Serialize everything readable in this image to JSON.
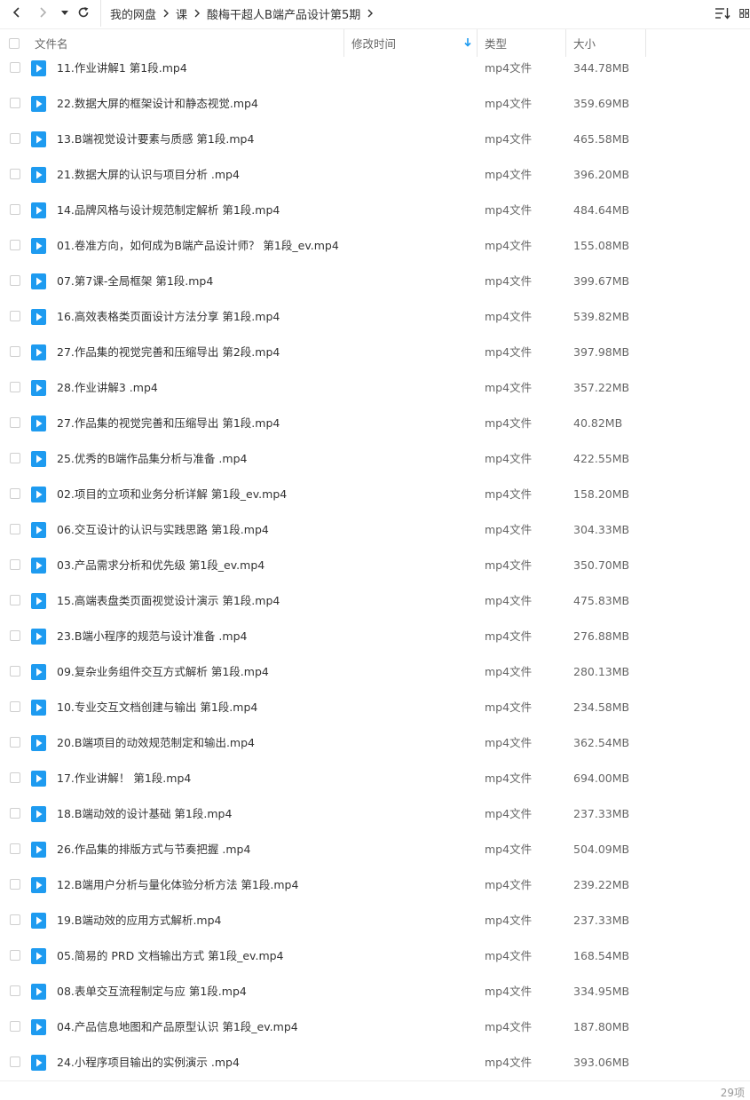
{
  "breadcrumb": [
    "我的网盘",
    "课",
    "酸梅干超人B端产品设计第5期"
  ],
  "columns": {
    "name": "文件名",
    "modified": "修改时间",
    "type": "类型",
    "size": "大小"
  },
  "colors": {
    "file_icon": "#1e9bf0",
    "sort_arrow": "#1e9bf0"
  },
  "files": [
    {
      "name": "11.作业讲解1 第1段.mp4",
      "type": "mp4文件",
      "size": "344.78MB"
    },
    {
      "name": "22.数据大屏的框架设计和静态视觉.mp4",
      "type": "mp4文件",
      "size": "359.69MB"
    },
    {
      "name": "13.B端视觉设计要素与质感 第1段.mp4",
      "type": "mp4文件",
      "size": "465.58MB"
    },
    {
      "name": "21.数据大屏的认识与项目分析 .mp4",
      "type": "mp4文件",
      "size": "396.20MB"
    },
    {
      "name": "14.品牌风格与设计规范制定解析 第1段.mp4",
      "type": "mp4文件",
      "size": "484.64MB"
    },
    {
      "name": "01.卷准方向，如何成为B端产品设计师？ 第1段_ev.mp4",
      "type": "mp4文件",
      "size": "155.08MB"
    },
    {
      "name": "07.第7课-全局框架 第1段.mp4",
      "type": "mp4文件",
      "size": "399.67MB"
    },
    {
      "name": "16.高效表格类页面设计方法分享 第1段.mp4",
      "type": "mp4文件",
      "size": "539.82MB"
    },
    {
      "name": "27.作品集的视觉完善和压缩导出 第2段.mp4",
      "type": "mp4文件",
      "size": "397.98MB"
    },
    {
      "name": "28.作业讲解3 .mp4",
      "type": "mp4文件",
      "size": "357.22MB"
    },
    {
      "name": "27.作品集的视觉完善和压缩导出 第1段.mp4",
      "type": "mp4文件",
      "size": "40.82MB"
    },
    {
      "name": "25.优秀的B端作品集分析与准备 .mp4",
      "type": "mp4文件",
      "size": "422.55MB"
    },
    {
      "name": "02.项目的立项和业务分析详解 第1段_ev.mp4",
      "type": "mp4文件",
      "size": "158.20MB"
    },
    {
      "name": "06.交互设计的认识与实践思路 第1段.mp4",
      "type": "mp4文件",
      "size": "304.33MB"
    },
    {
      "name": "03.产品需求分析和优先级 第1段_ev.mp4",
      "type": "mp4文件",
      "size": "350.70MB"
    },
    {
      "name": "15.高端表盘类页面视觉设计演示 第1段.mp4",
      "type": "mp4文件",
      "size": "475.83MB"
    },
    {
      "name": "23.B端小程序的规范与设计准备 .mp4",
      "type": "mp4文件",
      "size": "276.88MB"
    },
    {
      "name": "09.复杂业务组件交互方式解析 第1段.mp4",
      "type": "mp4文件",
      "size": "280.13MB"
    },
    {
      "name": "10.专业交互文档创建与输出 第1段.mp4",
      "type": "mp4文件",
      "size": "234.58MB"
    },
    {
      "name": "20.B端项目的动效规范制定和输出.mp4",
      "type": "mp4文件",
      "size": "362.54MB"
    },
    {
      "name": "17.作业讲解！ 第1段.mp4",
      "type": "mp4文件",
      "size": "694.00MB"
    },
    {
      "name": "18.B端动效的设计基础 第1段.mp4",
      "type": "mp4文件",
      "size": "237.33MB"
    },
    {
      "name": "26.作品集的排版方式与节奏把握 .mp4",
      "type": "mp4文件",
      "size": "504.09MB"
    },
    {
      "name": "12.B端用户分析与量化体验分析方法 第1段.mp4",
      "type": "mp4文件",
      "size": "239.22MB"
    },
    {
      "name": "19.B端动效的应用方式解析.mp4",
      "type": "mp4文件",
      "size": "237.33MB"
    },
    {
      "name": "05.简易的 PRD 文档输出方式 第1段_ev.mp4",
      "type": "mp4文件",
      "size": "168.54MB"
    },
    {
      "name": "08.表单交互流程制定与应 第1段.mp4",
      "type": "mp4文件",
      "size": "334.95MB"
    },
    {
      "name": "04.产品信息地图和产品原型认识 第1段_ev.mp4",
      "type": "mp4文件",
      "size": "187.80MB"
    },
    {
      "name": "24.小程序项目输出的实例演示 .mp4",
      "type": "mp4文件",
      "size": "393.06MB"
    }
  ],
  "footer": {
    "count_label": "29项"
  }
}
